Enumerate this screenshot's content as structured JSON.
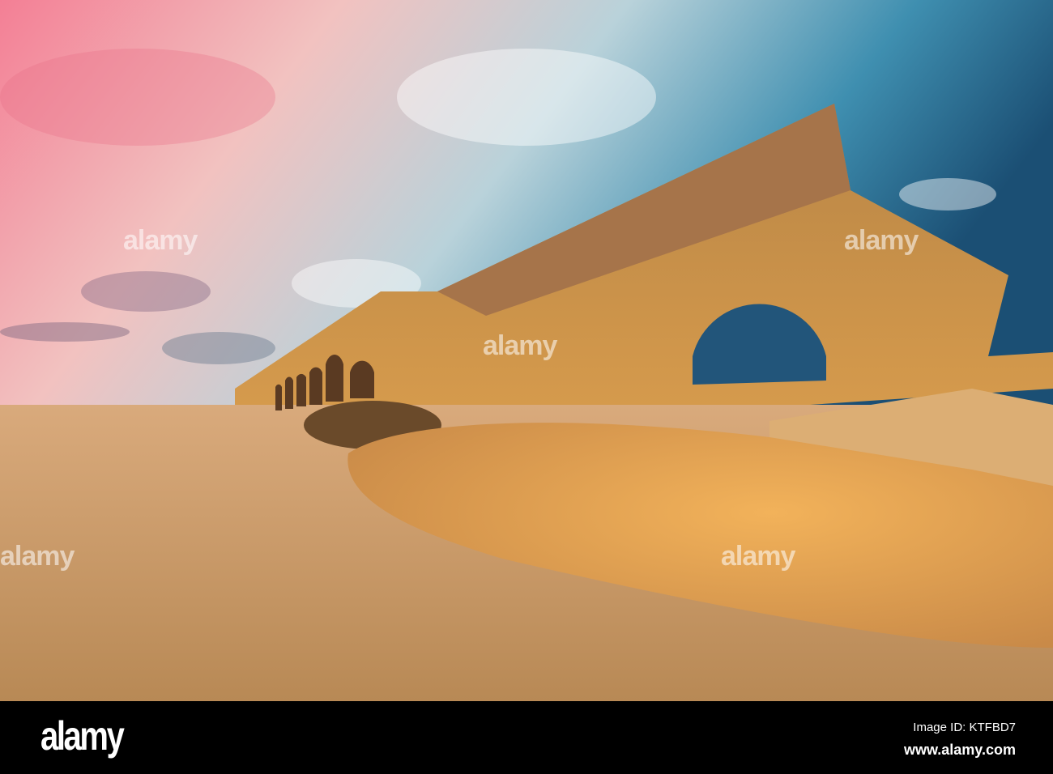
{
  "photo": {
    "subject": "Roman aqueduct on beach at sunset",
    "watermark": "alamy"
  },
  "footer": {
    "logo": "alamy",
    "image_id": "Image ID: KTFBD7",
    "website": "www.alamy.com"
  },
  "colors": {
    "sky_left": "#f08aa0",
    "sky_right": "#1f5f84",
    "stone": "#c98a44",
    "sand": "#c89a6a"
  }
}
